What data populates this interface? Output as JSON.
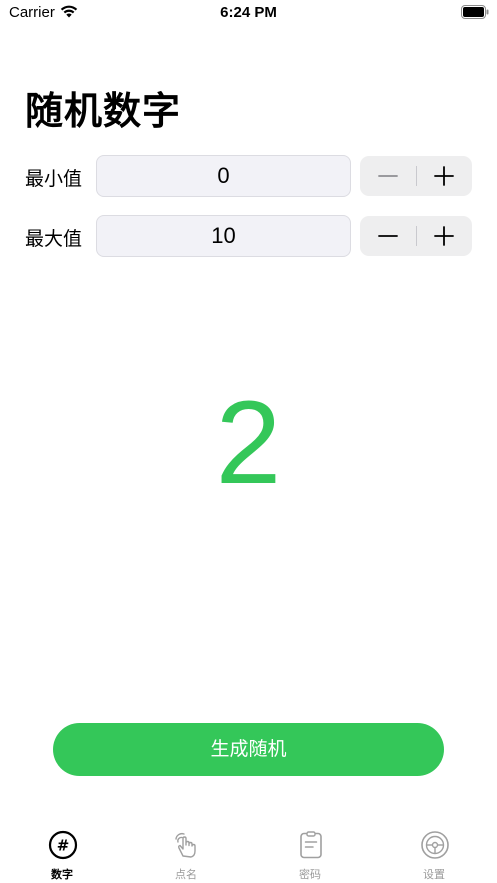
{
  "status_bar": {
    "carrier": "Carrier",
    "time": "6:24 PM"
  },
  "title": "随机数字",
  "min_row": {
    "label": "最小值",
    "value": "0"
  },
  "max_row": {
    "label": "最大值",
    "value": "10"
  },
  "result": "2",
  "generate_button": "生成随机",
  "tabs": [
    {
      "label": "数字",
      "icon": "hash-icon",
      "active": true
    },
    {
      "label": "点名",
      "icon": "hand-tap-icon",
      "active": false
    },
    {
      "label": "密码",
      "icon": "clipboard-icon",
      "active": false
    },
    {
      "label": "设置",
      "icon": "steering-wheel-icon",
      "active": false
    }
  ],
  "colors": {
    "accent": "#34c759",
    "field_bg": "#f2f2f7",
    "stepper_bg": "#eeeeef",
    "tab_inactive": "#9a9a9a"
  }
}
